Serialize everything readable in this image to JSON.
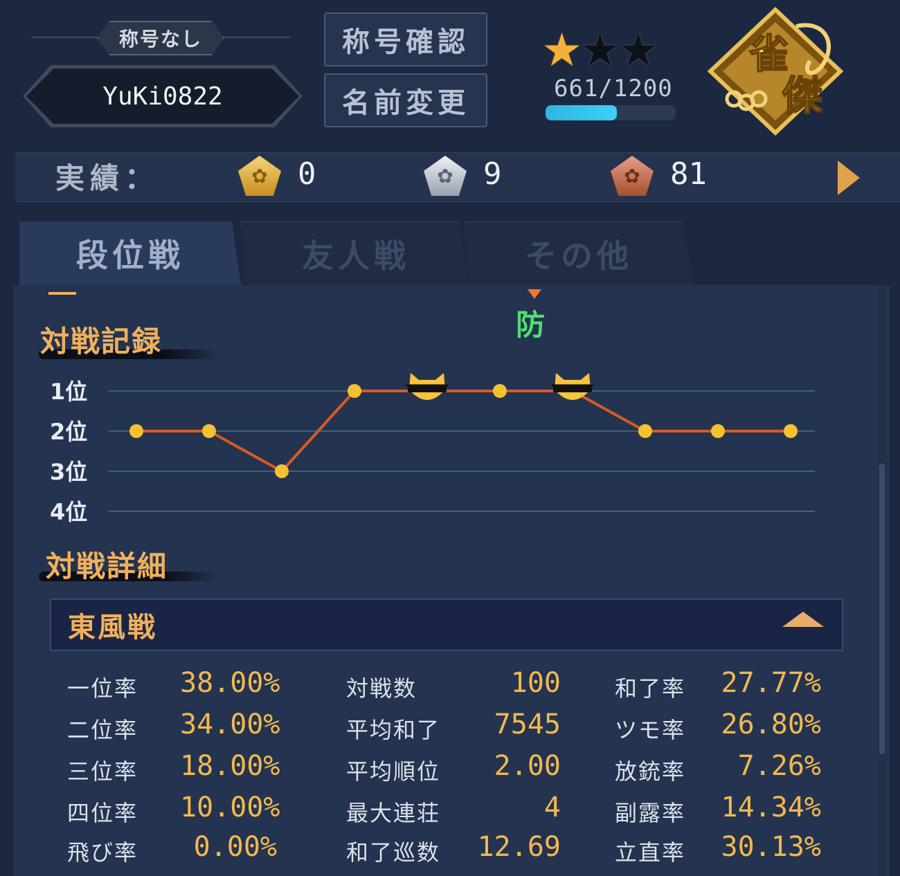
{
  "profile": {
    "title_badge": "称号なし",
    "player_name": "YuKi0822",
    "btn_title_check": "称号確認",
    "btn_rename": "名前変更",
    "stars": [
      "filled",
      "empty",
      "empty"
    ],
    "exp_text": "661/1200",
    "exp_progress": 0.55,
    "rank_emblem_text": "雀傑"
  },
  "achievements": {
    "label": "実績：",
    "gold": "0",
    "silver": "9",
    "bronze": "81"
  },
  "tabs": [
    "段位戦",
    "友人戦",
    "その他"
  ],
  "record_title": "対戦記録",
  "defend_label": "防",
  "chart_data": {
    "type": "line",
    "y_tick_labels": [
      "1位",
      "2位",
      "3位",
      "4位"
    ],
    "y_range": [
      1,
      4
    ],
    "y_inverted": true,
    "x": [
      1,
      2,
      3,
      4,
      5,
      6,
      7,
      8,
      9,
      10
    ],
    "values": [
      2,
      2,
      3,
      1,
      1,
      1,
      1,
      2,
      2,
      2
    ],
    "cat_icon_games": [
      5,
      7
    ],
    "line_color": "#d85a26",
    "point_color": "#f6c12e",
    "grid": true
  },
  "details_title": "対戦詳細",
  "mode_label": "東風戦",
  "stats": [
    [
      {
        "label": "一位率",
        "value": "38.00%"
      },
      {
        "label": "二位率",
        "value": "34.00%"
      },
      {
        "label": "三位率",
        "value": "18.00%"
      },
      {
        "label": "四位率",
        "value": "10.00%"
      },
      {
        "label": "飛び率",
        "value": "0.00%"
      }
    ],
    [
      {
        "label": "対戦数",
        "value": "100"
      },
      {
        "label": "平均和了",
        "value": "7545"
      },
      {
        "label": "平均順位",
        "value": "2.00"
      },
      {
        "label": "最大連荘",
        "value": "4"
      },
      {
        "label": "和了巡数",
        "value": "12.69"
      }
    ],
    [
      {
        "label": "和了率",
        "value": "27.77%"
      },
      {
        "label": "ツモ率",
        "value": "26.80%"
      },
      {
        "label": "放銃率",
        "value": "7.26%"
      },
      {
        "label": "副露率",
        "value": "14.34%"
      },
      {
        "label": "立直率",
        "value": "30.13%"
      }
    ]
  ]
}
